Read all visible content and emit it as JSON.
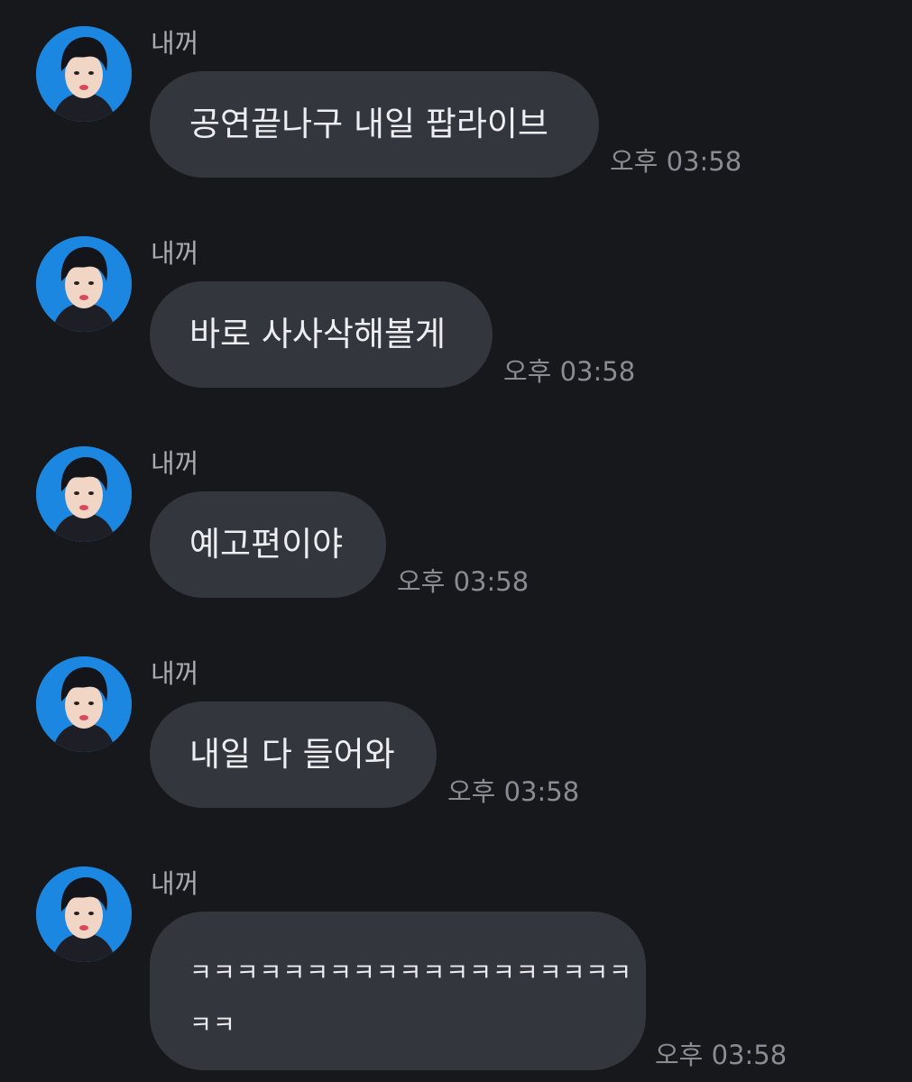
{
  "chat": {
    "messages": [
      {
        "sender": "내꺼",
        "text": "공연끝나구 내일 팝라이브",
        "time": "오후 03:58"
      },
      {
        "sender": "내꺼",
        "text": "바로 사사삭해볼게",
        "time": "오후 03:58"
      },
      {
        "sender": "내꺼",
        "text": "예고편이야",
        "time": "오후 03:58"
      },
      {
        "sender": "내꺼",
        "text": "내일 다 들어와",
        "time": "오후 03:58"
      },
      {
        "sender": "내꺼",
        "text_line1": "ㅋㅋㅋㅋㅋㅋㅋㅋㅋㅋㅋㅋㅋㅋㅋㅋㅋㅋㅋ",
        "text_line2": "ㅋㅋ",
        "time": "오후 03:58"
      }
    ]
  },
  "colors": {
    "background": "#17181b",
    "bubble": "#33363c",
    "avatar_bg": "#1c87e0"
  },
  "icons": {
    "avatar": "profile-photo"
  }
}
